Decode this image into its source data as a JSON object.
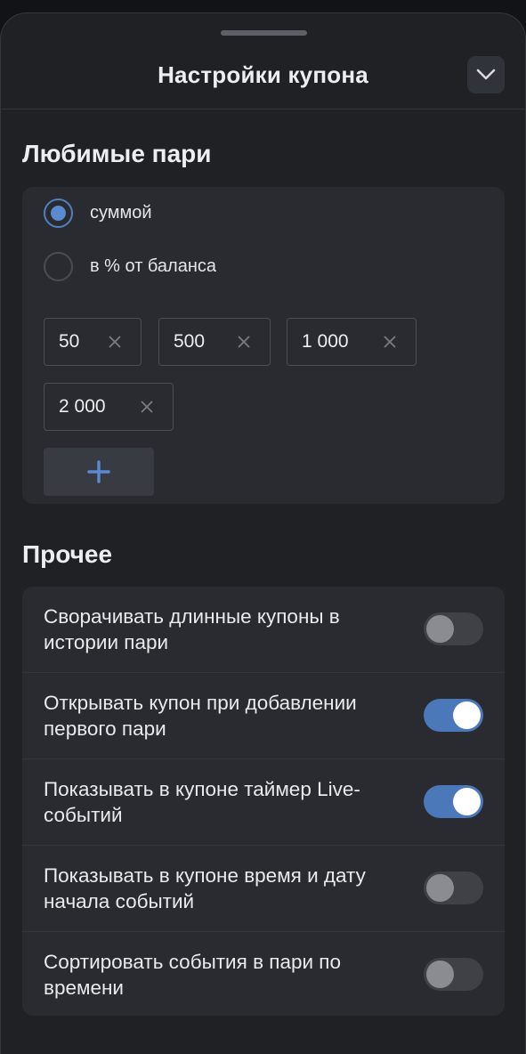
{
  "header": {
    "title": "Настройки купона"
  },
  "favorite_bets": {
    "title": "Любимые пари",
    "mode_options": [
      {
        "label": "суммой",
        "selected": true
      },
      {
        "label": "в % от баланса",
        "selected": false
      }
    ],
    "amounts": [
      "50",
      "500",
      "1 000",
      "2 000"
    ],
    "add_label": "+"
  },
  "other": {
    "title": "Прочее",
    "settings": [
      {
        "label": "Сворачивать длинные купоны в истории пари",
        "enabled": false
      },
      {
        "label": "Открывать купон при добавлении первого пари",
        "enabled": true
      },
      {
        "label": "Показывать в купоне таймер Live-событий",
        "enabled": true
      },
      {
        "label": "Показывать в купоне время и дату начала событий",
        "enabled": false
      },
      {
        "label": "Сортировать события в пари по времени",
        "enabled": false
      }
    ]
  },
  "icons": {
    "collapse": "chevron-down-icon",
    "chip_remove": "close-icon",
    "add": "plus-icon"
  },
  "colors": {
    "background": "#202125",
    "card": "#2a2b30",
    "accent": "#5b8ad0",
    "toggle_on": "#4a78b8",
    "toggle_off": "#3f4147"
  }
}
